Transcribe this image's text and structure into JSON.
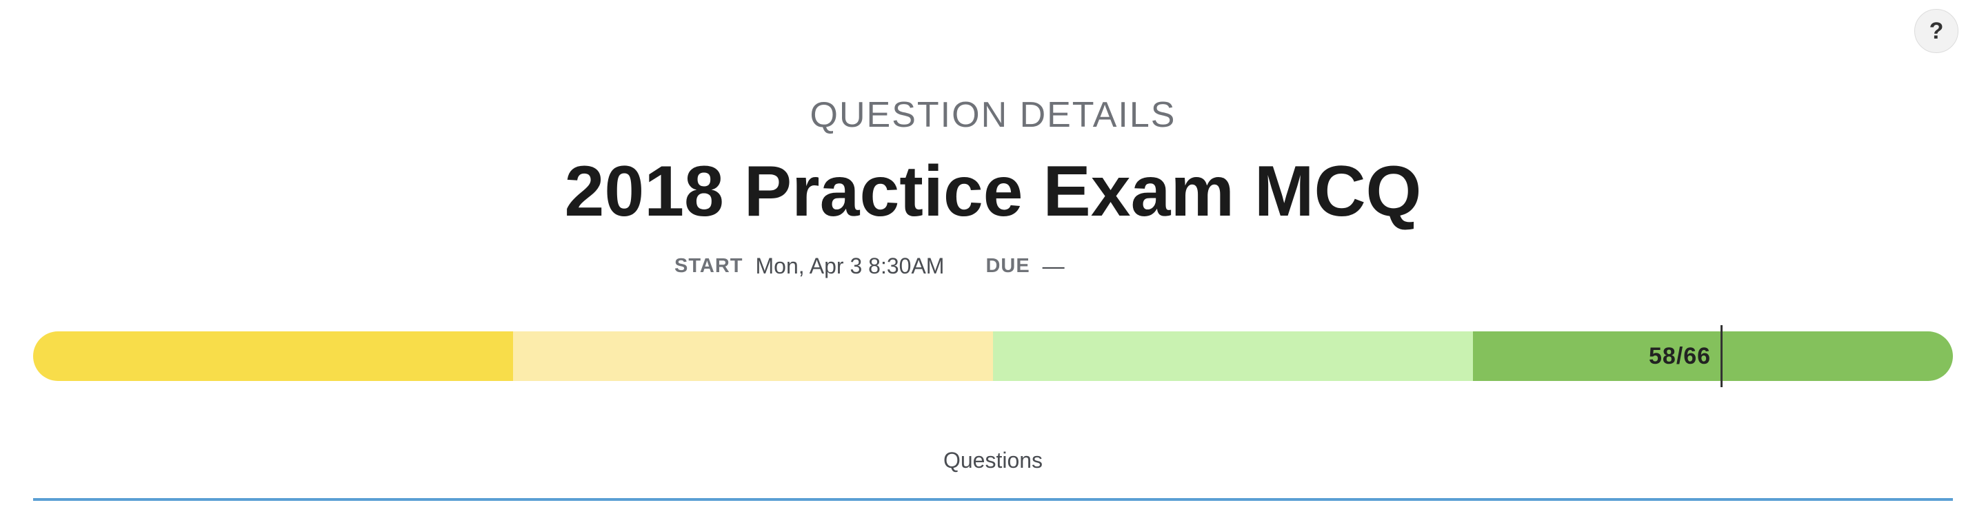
{
  "help": {
    "label": "?"
  },
  "header": {
    "eyebrow": "QUESTION DETAILS",
    "title": "2018 Practice Exam MCQ"
  },
  "meta": {
    "start_label": "START",
    "start_value": "Mon, Apr 3 8:30AM",
    "due_label": "DUE",
    "due_value": "—"
  },
  "progress": {
    "label": "58/66",
    "completed": 58,
    "total": 66,
    "segment_colors": [
      "#f8dd4a",
      "#fcecab",
      "#c9f2b1",
      "#84c15c"
    ]
  },
  "tabs": {
    "active_label": "Questions",
    "underline_color": "#5a9fd4"
  }
}
